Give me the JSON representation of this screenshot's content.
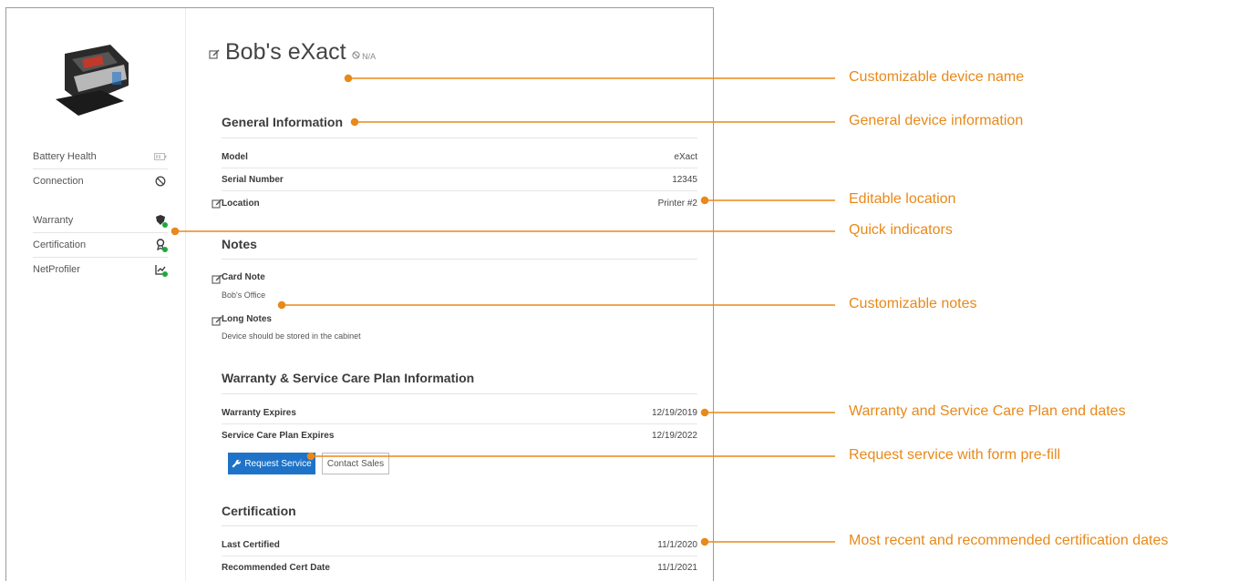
{
  "device": {
    "name": "Bob's eXact",
    "status": "N/A"
  },
  "sidebar": {
    "status_items": [
      {
        "label": "Battery Health",
        "icon": "battery-icon"
      },
      {
        "label": "Connection",
        "icon": "no-connection-icon"
      }
    ],
    "indicators": [
      {
        "label": "Warranty",
        "icon": "warranty-shield-icon"
      },
      {
        "label": "Certification",
        "icon": "certification-badge-icon"
      },
      {
        "label": "NetProfiler",
        "icon": "netprofiler-chart-icon"
      }
    ]
  },
  "general": {
    "heading": "General Information",
    "rows": [
      {
        "key": "Model",
        "value": "eXact"
      },
      {
        "key": "Serial Number",
        "value": "12345"
      },
      {
        "key": "Location",
        "value": "Printer #2"
      }
    ]
  },
  "notes": {
    "heading": "Notes",
    "card_note_label": "Card Note",
    "card_note_value": "Bob's Office",
    "long_notes_label": "Long Notes",
    "long_notes_value": "Device should be stored in the cabinet"
  },
  "warranty": {
    "heading": "Warranty & Service Care Plan Information",
    "rows": [
      {
        "key": "Warranty Expires",
        "value": "12/19/2019"
      },
      {
        "key": "Service Care Plan Expires",
        "value": "12/19/2022"
      }
    ],
    "request_service_label": "Request Service",
    "contact_sales_label": "Contact Sales"
  },
  "certification": {
    "heading": "Certification",
    "rows": [
      {
        "key": "Last Certified",
        "value": "11/1/2020"
      },
      {
        "key": "Recommended Cert Date",
        "value": "11/1/2021"
      }
    ]
  },
  "callouts": [
    "Customizable device name",
    "General device information",
    "Editable location",
    "Quick indicators",
    "Customizable notes",
    "Warranty and Service Care Plan end dates",
    "Request service with form pre-fill",
    "Most recent and recommended certification dates"
  ],
  "colors": {
    "accent": "#e8891a",
    "primary_button": "#1e73c8",
    "indicator_ok": "#1fa83a"
  }
}
